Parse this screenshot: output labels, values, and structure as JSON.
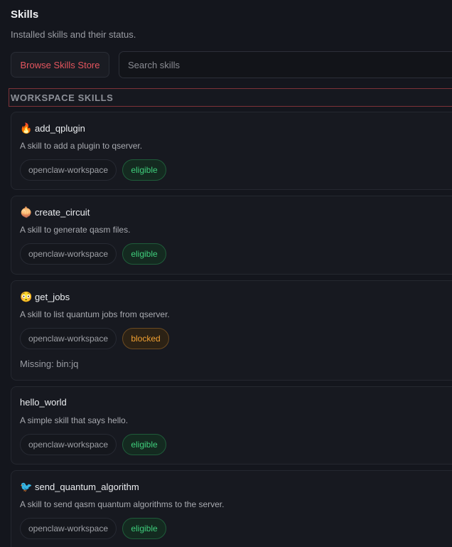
{
  "header": {
    "title": "Skills",
    "subtitle": "Installed skills and their status."
  },
  "toolbar": {
    "store_label": "Browse Skills Store",
    "search_placeholder": "Search skills"
  },
  "section": {
    "label": "WORKSPACE SKILLS"
  },
  "skills": [
    {
      "emoji": "🔥",
      "emoji_icon": "fire-icon",
      "name": "add_qplugin",
      "description": "A skill to add a plugin to qserver.",
      "source": "openclaw-workspace",
      "status": "eligible"
    },
    {
      "emoji": "🧅",
      "emoji_icon": "onion-icon",
      "name": "create_circuit",
      "description": "A skill to generate qasm files.",
      "source": "openclaw-workspace",
      "status": "eligible"
    },
    {
      "emoji": "😳",
      "emoji_icon": "flushed-face-icon",
      "name": "get_jobs",
      "description": "A skill to list quantum jobs from qserver.",
      "source": "openclaw-workspace",
      "status": "blocked",
      "missing": "Missing: bin:jq"
    },
    {
      "emoji": "",
      "name": "hello_world",
      "description": "A simple skill that says hello.",
      "source": "openclaw-workspace",
      "status": "eligible"
    },
    {
      "emoji": "🐦",
      "emoji_icon": "bird-icon",
      "name": "send_quantum_algorithm",
      "description": "A skill to send qasm quantum algorithms to the server.",
      "source": "openclaw-workspace",
      "status": "eligible"
    }
  ],
  "colors": {
    "background": "#14161d",
    "accent": "#e4555e",
    "eligible": "#3fcf7c",
    "blocked": "#f0a032"
  }
}
